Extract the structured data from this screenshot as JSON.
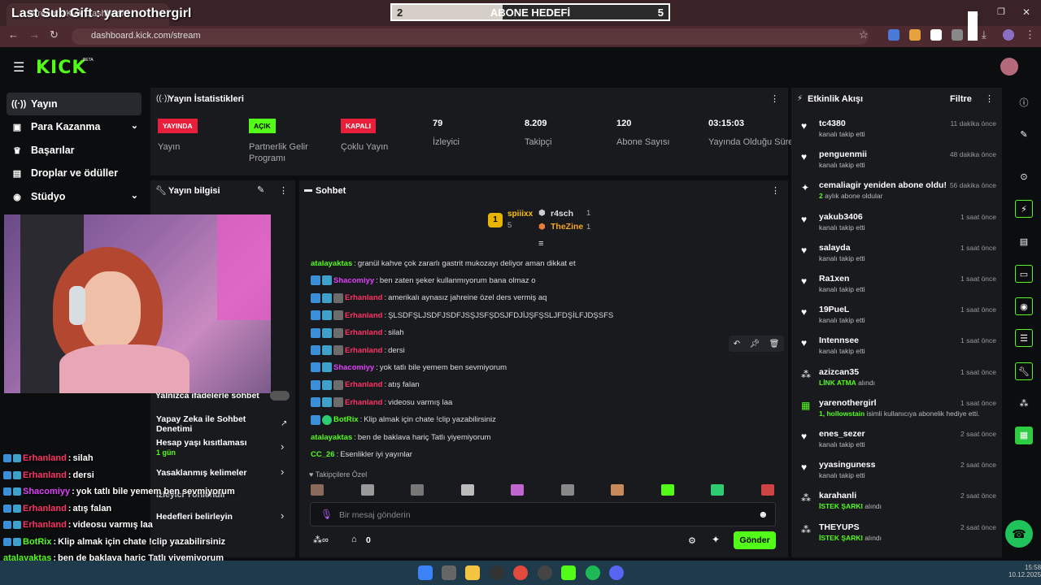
{
  "browser": {
    "tab_title": "Stream - Kick Dashboard",
    "url": "dashboard.kick.com/stream"
  },
  "overlay": {
    "last_sub": "Last Sub Gift : yarenothergirl",
    "goal_title": "ABONE HEDEFİ",
    "goal_current": "2",
    "goal_target": "5",
    "goal_progress": 0.4
  },
  "brand": {
    "logo": "KICK",
    "beta": "BETA",
    "accent": "#53fc18"
  },
  "sidebar": {
    "items": [
      {
        "label": "Yayın",
        "icon": "broadcast-icon",
        "active": true
      },
      {
        "label": "Para Kazanma",
        "icon": "money-icon",
        "chevron": true
      },
      {
        "label": "Başarılar",
        "icon": "trophy-icon"
      },
      {
        "label": "Droplar ve ödüller",
        "icon": "gift-icon"
      },
      {
        "label": "Stüdyo",
        "icon": "camera-icon",
        "chevron": true
      }
    ]
  },
  "stats": {
    "title": "Yayın İstatistikleri",
    "items": [
      {
        "badge": "YAYINDA",
        "badge_color": "#e91e3a",
        "label": "Yayın"
      },
      {
        "badge": "AÇIK",
        "badge_color": "#53fc18",
        "label": "Partnerlik Gelir Programı"
      },
      {
        "badge": "KAPALI",
        "badge_color": "#e91e3a",
        "label": "Çoklu Yayın"
      },
      {
        "value": "79",
        "label": "İzleyici"
      },
      {
        "value": "8.209",
        "label": "Takipçi"
      },
      {
        "value": "120",
        "label": "Abone Sayısı"
      },
      {
        "value": "03:15:03",
        "label": "Yayında Olduğu Süre"
      }
    ]
  },
  "info": {
    "title": "Yayın bilgisi",
    "rows": [
      "Yalnızca ifadelerle sohbet",
      "Yapay Zeka ile Sohbet Denetimi",
      "Hesap yaşı kısıtlaması",
      "1 gün",
      "Yasaklanmış kelimeler",
      "İzleyici Yönlendir",
      "Hedefleri belirleyin"
    ]
  },
  "chat": {
    "title": "Sohbet",
    "top": {
      "first": "spiiixx",
      "first_count": "5",
      "second": "r4sch",
      "second_count": "1",
      "third": "TheZine",
      "third_count": "1"
    },
    "messages": [
      {
        "user": "atalayaktas",
        "color": "#53fc18",
        "text": "granül kahve çok zararlı gastrit mukozayı deliyor aman dikkat et",
        "badges": []
      },
      {
        "user": "Shacomiyy",
        "color": "#e040fb",
        "text": "ben zaten şeker kullanmıyorum bana olmaz o",
        "badges": [
          "b1",
          "b2"
        ]
      },
      {
        "user": "Erhanland",
        "color": "#ff3366",
        "text": "amerikalı aynasız jahreine özel ders vermiş aq",
        "badges": [
          "b1",
          "b2",
          "b3"
        ]
      },
      {
        "user": "Erhanland",
        "color": "#ff3366",
        "text": "ŞLSDFŞLJSDFJSDFJSŞJSFŞDSJFDJİJŞFŞSLJFDŞİLFJDŞSFS",
        "badges": [
          "b1",
          "b2",
          "b3"
        ]
      },
      {
        "user": "Erhanland",
        "color": "#ff3366",
        "text": "silah",
        "badges": [
          "b1",
          "b2",
          "b3"
        ]
      },
      {
        "user": "Erhanland",
        "color": "#ff3366",
        "text": "dersi",
        "badges": [
          "b1",
          "b2",
          "b3"
        ]
      },
      {
        "user": "Shacomiyy",
        "color": "#e040fb",
        "text": "yok tatlı bile yemem ben sevmiyorum",
        "badges": [
          "b1",
          "b2"
        ]
      },
      {
        "user": "Erhanland",
        "color": "#ff3366",
        "text": "atış falan",
        "badges": [
          "b1",
          "b2",
          "b3"
        ]
      },
      {
        "user": "Erhanland",
        "color": "#ff3366",
        "text": "videosu varmış laa",
        "badges": [
          "b1",
          "b2",
          "b3"
        ]
      },
      {
        "user": "BotRix",
        "color": "#53fc18",
        "text": "Klip almak için chate !clip yazabilirsiniz",
        "badges": [
          "b1",
          "b4"
        ]
      },
      {
        "user": "atalayaktas",
        "color": "#53fc18",
        "text": "ben de baklava hariç Tatlı yiyemiyorum",
        "badges": []
      },
      {
        "user": "CC_26",
        "color": "#53fc18",
        "text": "Esenlikler iyi yayınlar",
        "badges": []
      }
    ],
    "followers_label": "Takipçilere Özel",
    "input_placeholder": "Bir mesaj gönderin",
    "send": "Gönder",
    "points": "0"
  },
  "activity": {
    "title": "Etkinlik Akışı",
    "filter": "Filtre",
    "items": [
      {
        "name": "tc4380",
        "time": "11 dakika önce",
        "sub": "kanalı takip etti",
        "icon": "heart-icon"
      },
      {
        "name": "penguenmii",
        "time": "48 dakika önce",
        "sub": "kanalı takip etti",
        "icon": "heart-icon"
      },
      {
        "name": "cemaliagir yeniden abone oldu!",
        "time": "56 dakika önce",
        "sub": "aylık abone oldular",
        "hl": "2",
        "icon": "star-icon"
      },
      {
        "name": "yakub3406",
        "time": "1 saat önce",
        "sub": "kanalı takip etti",
        "icon": "heart-icon"
      },
      {
        "name": "salayda",
        "time": "1 saat önce",
        "sub": "kanalı takip etti",
        "icon": "heart-icon"
      },
      {
        "name": "Ra1xen",
        "time": "1 saat önce",
        "sub": "kanalı takip etti",
        "icon": "heart-icon"
      },
      {
        "name": "19PueL",
        "time": "1 saat önce",
        "sub": "kanalı takip etti",
        "icon": "heart-icon"
      },
      {
        "name": "Intennsee",
        "time": "1 saat önce",
        "sub": "kanalı takip etti",
        "icon": "heart-icon"
      },
      {
        "name": "azizcan35",
        "time": "1 saat önce",
        "sub": "alındı",
        "hl": "LİNK ATMA",
        "icon": "reward-icon"
      },
      {
        "name": "yarenothergirl",
        "time": "1 saat önce",
        "sub": "isimli kullanıcıya abonelik hediye etti.",
        "hl": "1, hollowstain",
        "icon": "gift-icon"
      },
      {
        "name": "enes_sezer",
        "time": "2 saat önce",
        "sub": "kanalı takip etti",
        "icon": "heart-icon"
      },
      {
        "name": "yyasinguness",
        "time": "2 saat önce",
        "sub": "kanalı takip etti",
        "icon": "heart-icon"
      },
      {
        "name": "karahanli",
        "time": "2 saat önce",
        "sub": "alındı",
        "hl": "İSTEK ŞARKI",
        "icon": "reward-icon"
      },
      {
        "name": "THEYUPS",
        "time": "2 saat önce",
        "sub": "alındı",
        "hl": "İSTEK ŞARKI",
        "icon": "reward-icon"
      }
    ]
  },
  "overlay_chat": [
    {
      "user": "Erhanland",
      "color": "#ff3366",
      "text": "silah"
    },
    {
      "user": "Erhanland",
      "color": "#ff3366",
      "text": "dersi"
    },
    {
      "user": "Shacomiyy",
      "color": "#e040fb",
      "text": "yok tatlı bile yemem ben sevmiyorum"
    },
    {
      "user": "Erhanland",
      "color": "#ff3366",
      "text": "atış falan"
    },
    {
      "user": "Erhanland",
      "color": "#ff3366",
      "text": "videosu varmış laa"
    },
    {
      "user": "BotRix",
      "color": "#53fc18",
      "text": "Klip almak için chate !clip yazabilirsiniz"
    },
    {
      "user": "atalayaktas",
      "color": "#53fc18",
      "text": "ben de baklava hariç Tatlı yiyemiyorum"
    },
    {
      "user": "CC_26",
      "color": "#53fc18",
      "text": "Esenlikler iyi yayınlar"
    }
  ],
  "taskbar": {
    "time": "15:58",
    "date": "10.12.2025"
  }
}
